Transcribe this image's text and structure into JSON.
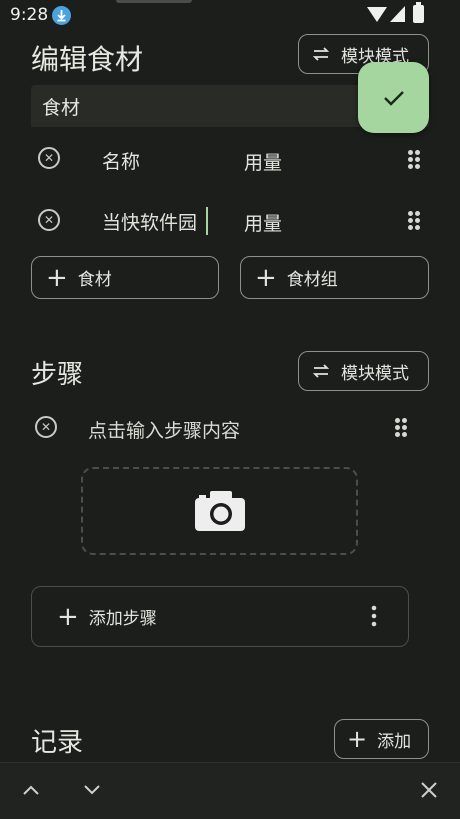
{
  "status_bar": {
    "time": "9:28"
  },
  "ingredients": {
    "title": "编辑食材",
    "mode_button": "模块模式",
    "search_value": "食材",
    "rows": [
      {
        "name": "名称",
        "amount": "用量"
      },
      {
        "name": "当快软件园",
        "amount": "用量"
      }
    ],
    "add_ingredient": "食材",
    "add_group": "食材组"
  },
  "steps": {
    "title": "步骤",
    "mode_button": "模块模式",
    "step_placeholder": "点击输入步骤内容",
    "add_step": "添加步骤"
  },
  "records": {
    "title": "记录",
    "add_button": "添加"
  },
  "colors": {
    "background": "#1b1e1a",
    "fab": "#a5d6a0",
    "accent": "#a5d6a0"
  },
  "icons": [
    "download-icon",
    "wifi-icon",
    "signal-icon",
    "battery-icon",
    "swap-icon",
    "check-icon",
    "remove-icon",
    "drag-handle-icon",
    "plus-icon",
    "camera-icon",
    "more-vert-icon",
    "chevron-up-icon",
    "chevron-down-icon",
    "close-icon"
  ]
}
